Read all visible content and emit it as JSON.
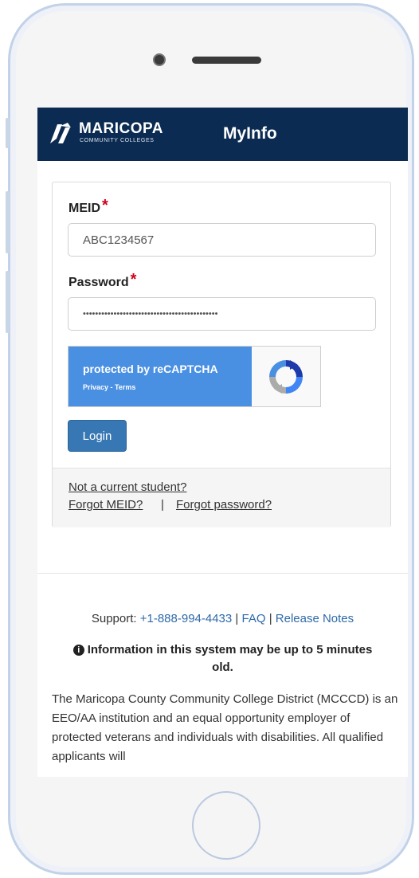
{
  "header": {
    "logo_name": "MARICOPA",
    "logo_sub": "COMMUNITY COLLEGES",
    "app_title": "MyInfo"
  },
  "form": {
    "meid_label": "MEID",
    "meid_value": "ABC1234567",
    "password_label": "Password",
    "password_value": "••••••••••••••••••••••••••••••••••••••••••••",
    "required_mark": "*",
    "login_label": "Login"
  },
  "recaptcha": {
    "title": "protected by reCAPTCHA",
    "links": "Privacy - Terms"
  },
  "panel_footer": {
    "not_student": "Not a current student?",
    "forgot_meid": "Forgot MEID?",
    "separator": "|",
    "forgot_password": "Forgot password?"
  },
  "footer": {
    "support_label": "Support:",
    "phone": "+1-888-994-4433",
    "faq": "FAQ",
    "release_notes": "Release Notes",
    "separator": "|",
    "info_icon": "info-circle",
    "info_text": "Information in this system may be up to 5 minutes old.",
    "legal_text": "The Maricopa County Community College District (MCCCD) is an EEO/AA institution and an equal opportunity employer of protected veterans and individuals with disabilities. All qualified applicants will"
  },
  "colors": {
    "header_bg": "#0b2b52",
    "button_bg": "#3777b3",
    "recaptcha_blue": "#4a90e2",
    "required": "#d0021b",
    "link": "#2f6aa8"
  }
}
